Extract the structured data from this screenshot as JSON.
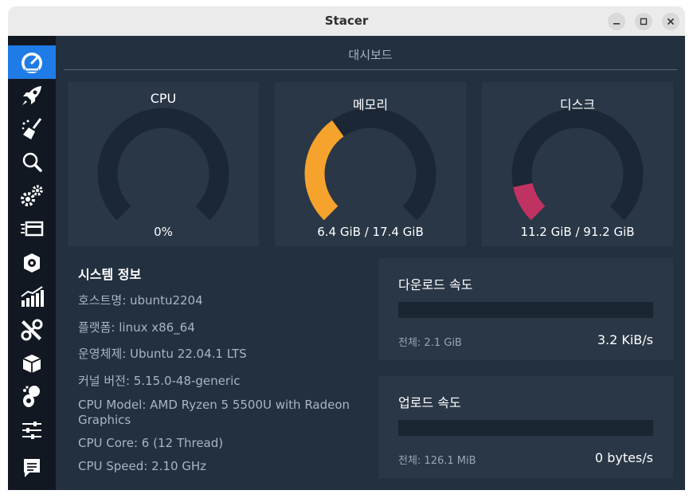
{
  "window": {
    "title": "Stacer"
  },
  "sidebar": {
    "items": [
      {
        "icon": "dashboard-icon",
        "active": true
      },
      {
        "icon": "rocket-icon"
      },
      {
        "icon": "broom-icon"
      },
      {
        "icon": "search-icon"
      },
      {
        "icon": "gears-icon"
      },
      {
        "icon": "processes-icon"
      },
      {
        "icon": "uninstaller-icon"
      },
      {
        "icon": "resources-chart-icon"
      },
      {
        "icon": "tools-icon"
      },
      {
        "icon": "package-icon"
      },
      {
        "icon": "gnome-icon"
      },
      {
        "icon": "settings-sliders-icon"
      },
      {
        "icon": "feedback-icon"
      }
    ]
  },
  "page": {
    "title": "대시보드"
  },
  "gauges": {
    "cpu": {
      "title": "CPU",
      "value": "0%",
      "percent": 0,
      "color": "#2ea44f"
    },
    "memory": {
      "title": "메모리",
      "value": "6.4 GiB / 17.4 GiB",
      "percent": 36.8,
      "color": "#f5a32c"
    },
    "disk": {
      "title": "디스크",
      "value": "11.2 GiB / 91.2 GiB",
      "percent": 12.3,
      "color": "#c03261"
    }
  },
  "system_info": {
    "title": "시스템 정보",
    "lines": [
      "호스트명: ubuntu2204",
      "플랫폼: linux x86_64",
      "운영체제: Ubuntu 22.04.1 LTS",
      "커널 버전: 5.15.0-48-generic",
      "CPU Model: AMD Ryzen 5 5500U with Radeon Graphics",
      "CPU Core: 6 (12 Thread)",
      "CPU Speed: 2.10 GHz"
    ]
  },
  "download": {
    "title": "다운로드 속도",
    "total": "전체: 2.1 GiB",
    "speed": "3.2 KiB/s"
  },
  "upload": {
    "title": "업로드 속도",
    "total": "전체: 126.1 MiB",
    "speed": "0 bytes/s"
  },
  "colors": {
    "accent": "#1f7ce6",
    "panel": "#293747",
    "background": "#223040",
    "sidebar": "#111822"
  }
}
